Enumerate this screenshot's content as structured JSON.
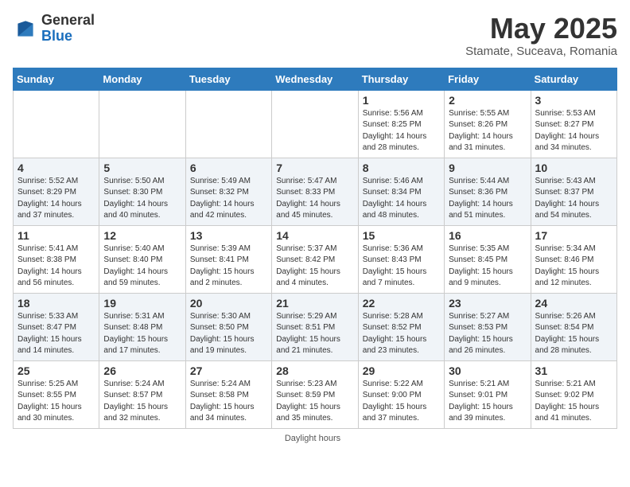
{
  "logo": {
    "general": "General",
    "blue": "Blue"
  },
  "title": "May 2025",
  "subtitle": "Stamate, Suceava, Romania",
  "weekdays": [
    "Sunday",
    "Monday",
    "Tuesday",
    "Wednesday",
    "Thursday",
    "Friday",
    "Saturday"
  ],
  "weeks": [
    [
      {
        "day": "",
        "info": ""
      },
      {
        "day": "",
        "info": ""
      },
      {
        "day": "",
        "info": ""
      },
      {
        "day": "",
        "info": ""
      },
      {
        "day": "1",
        "info": "Sunrise: 5:56 AM\nSunset: 8:25 PM\nDaylight: 14 hours and 28 minutes."
      },
      {
        "day": "2",
        "info": "Sunrise: 5:55 AM\nSunset: 8:26 PM\nDaylight: 14 hours and 31 minutes."
      },
      {
        "day": "3",
        "info": "Sunrise: 5:53 AM\nSunset: 8:27 PM\nDaylight: 14 hours and 34 minutes."
      }
    ],
    [
      {
        "day": "4",
        "info": "Sunrise: 5:52 AM\nSunset: 8:29 PM\nDaylight: 14 hours and 37 minutes."
      },
      {
        "day": "5",
        "info": "Sunrise: 5:50 AM\nSunset: 8:30 PM\nDaylight: 14 hours and 40 minutes."
      },
      {
        "day": "6",
        "info": "Sunrise: 5:49 AM\nSunset: 8:32 PM\nDaylight: 14 hours and 42 minutes."
      },
      {
        "day": "7",
        "info": "Sunrise: 5:47 AM\nSunset: 8:33 PM\nDaylight: 14 hours and 45 minutes."
      },
      {
        "day": "8",
        "info": "Sunrise: 5:46 AM\nSunset: 8:34 PM\nDaylight: 14 hours and 48 minutes."
      },
      {
        "day": "9",
        "info": "Sunrise: 5:44 AM\nSunset: 8:36 PM\nDaylight: 14 hours and 51 minutes."
      },
      {
        "day": "10",
        "info": "Sunrise: 5:43 AM\nSunset: 8:37 PM\nDaylight: 14 hours and 54 minutes."
      }
    ],
    [
      {
        "day": "11",
        "info": "Sunrise: 5:41 AM\nSunset: 8:38 PM\nDaylight: 14 hours and 56 minutes."
      },
      {
        "day": "12",
        "info": "Sunrise: 5:40 AM\nSunset: 8:40 PM\nDaylight: 14 hours and 59 minutes."
      },
      {
        "day": "13",
        "info": "Sunrise: 5:39 AM\nSunset: 8:41 PM\nDaylight: 15 hours and 2 minutes."
      },
      {
        "day": "14",
        "info": "Sunrise: 5:37 AM\nSunset: 8:42 PM\nDaylight: 15 hours and 4 minutes."
      },
      {
        "day": "15",
        "info": "Sunrise: 5:36 AM\nSunset: 8:43 PM\nDaylight: 15 hours and 7 minutes."
      },
      {
        "day": "16",
        "info": "Sunrise: 5:35 AM\nSunset: 8:45 PM\nDaylight: 15 hours and 9 minutes."
      },
      {
        "day": "17",
        "info": "Sunrise: 5:34 AM\nSunset: 8:46 PM\nDaylight: 15 hours and 12 minutes."
      }
    ],
    [
      {
        "day": "18",
        "info": "Sunrise: 5:33 AM\nSunset: 8:47 PM\nDaylight: 15 hours and 14 minutes."
      },
      {
        "day": "19",
        "info": "Sunrise: 5:31 AM\nSunset: 8:48 PM\nDaylight: 15 hours and 17 minutes."
      },
      {
        "day": "20",
        "info": "Sunrise: 5:30 AM\nSunset: 8:50 PM\nDaylight: 15 hours and 19 minutes."
      },
      {
        "day": "21",
        "info": "Sunrise: 5:29 AM\nSunset: 8:51 PM\nDaylight: 15 hours and 21 minutes."
      },
      {
        "day": "22",
        "info": "Sunrise: 5:28 AM\nSunset: 8:52 PM\nDaylight: 15 hours and 23 minutes."
      },
      {
        "day": "23",
        "info": "Sunrise: 5:27 AM\nSunset: 8:53 PM\nDaylight: 15 hours and 26 minutes."
      },
      {
        "day": "24",
        "info": "Sunrise: 5:26 AM\nSunset: 8:54 PM\nDaylight: 15 hours and 28 minutes."
      }
    ],
    [
      {
        "day": "25",
        "info": "Sunrise: 5:25 AM\nSunset: 8:55 PM\nDaylight: 15 hours and 30 minutes."
      },
      {
        "day": "26",
        "info": "Sunrise: 5:24 AM\nSunset: 8:57 PM\nDaylight: 15 hours and 32 minutes."
      },
      {
        "day": "27",
        "info": "Sunrise: 5:24 AM\nSunset: 8:58 PM\nDaylight: 15 hours and 34 minutes."
      },
      {
        "day": "28",
        "info": "Sunrise: 5:23 AM\nSunset: 8:59 PM\nDaylight: 15 hours and 35 minutes."
      },
      {
        "day": "29",
        "info": "Sunrise: 5:22 AM\nSunset: 9:00 PM\nDaylight: 15 hours and 37 minutes."
      },
      {
        "day": "30",
        "info": "Sunrise: 5:21 AM\nSunset: 9:01 PM\nDaylight: 15 hours and 39 minutes."
      },
      {
        "day": "31",
        "info": "Sunrise: 5:21 AM\nSunset: 9:02 PM\nDaylight: 15 hours and 41 minutes."
      }
    ]
  ],
  "footer": {
    "label": "Daylight hours"
  }
}
